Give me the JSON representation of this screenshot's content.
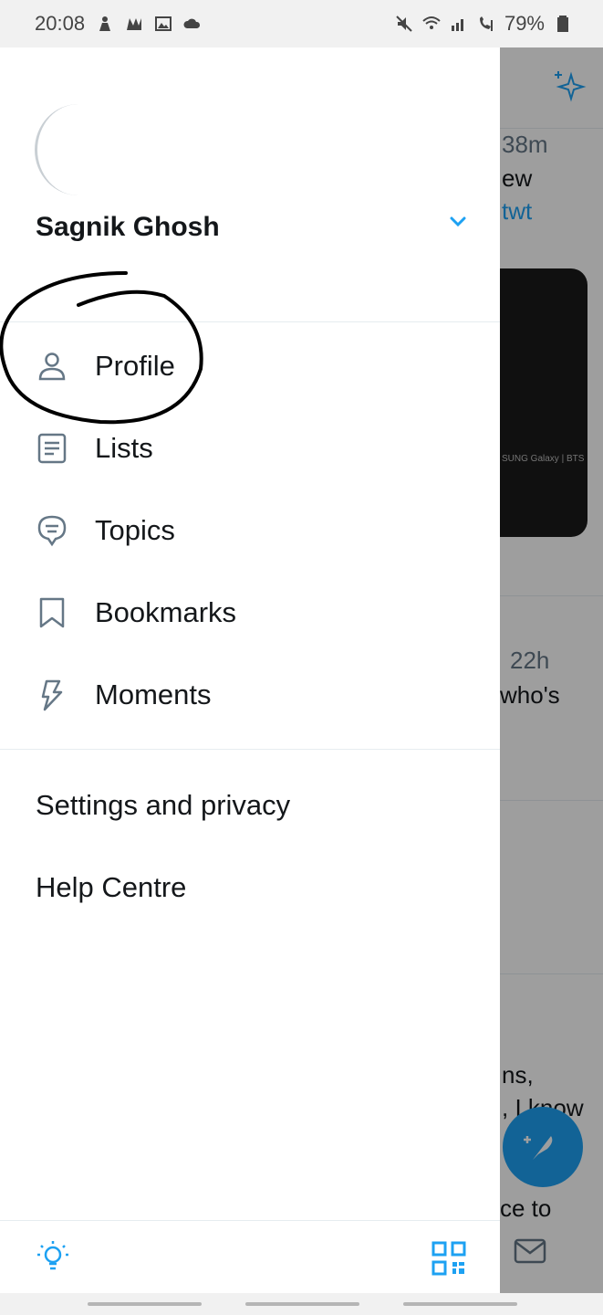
{
  "status_bar": {
    "time": "20:08",
    "battery": "79%",
    "left_icons": [
      "person-icon",
      "game-icon",
      "gallery-icon",
      "cloud-icon"
    ],
    "right_icons": [
      "mute-icon",
      "wifi-icon",
      "volte-signal-icon",
      "call-signal-icon",
      "battery-icon"
    ]
  },
  "drawer": {
    "user_name": "Sagnik Ghosh",
    "menu": [
      {
        "label": "Profile",
        "icon": "person-icon"
      },
      {
        "label": "Lists",
        "icon": "list-icon"
      },
      {
        "label": "Topics",
        "icon": "topic-bubble-icon"
      },
      {
        "label": "Bookmarks",
        "icon": "bookmark-icon"
      },
      {
        "label": "Moments",
        "icon": "lightning-icon"
      }
    ],
    "secondary": [
      {
        "label": "Settings and privacy"
      },
      {
        "label": "Help Centre"
      }
    ],
    "footer": {
      "left_icon": "lightbulb-icon",
      "right_icon": "qr-code-icon"
    }
  },
  "background_timeline": {
    "texts": [
      "38m",
      "ew",
      "twt",
      "22h",
      "who's",
      "ns,",
      ", I know",
      "ce to"
    ],
    "image_caption": "SUNG Galaxy | BTS"
  },
  "colors": {
    "accent": "#1da1f2",
    "text": "#14171a",
    "secondary_text": "#657786",
    "icon_gray": "#657786"
  }
}
